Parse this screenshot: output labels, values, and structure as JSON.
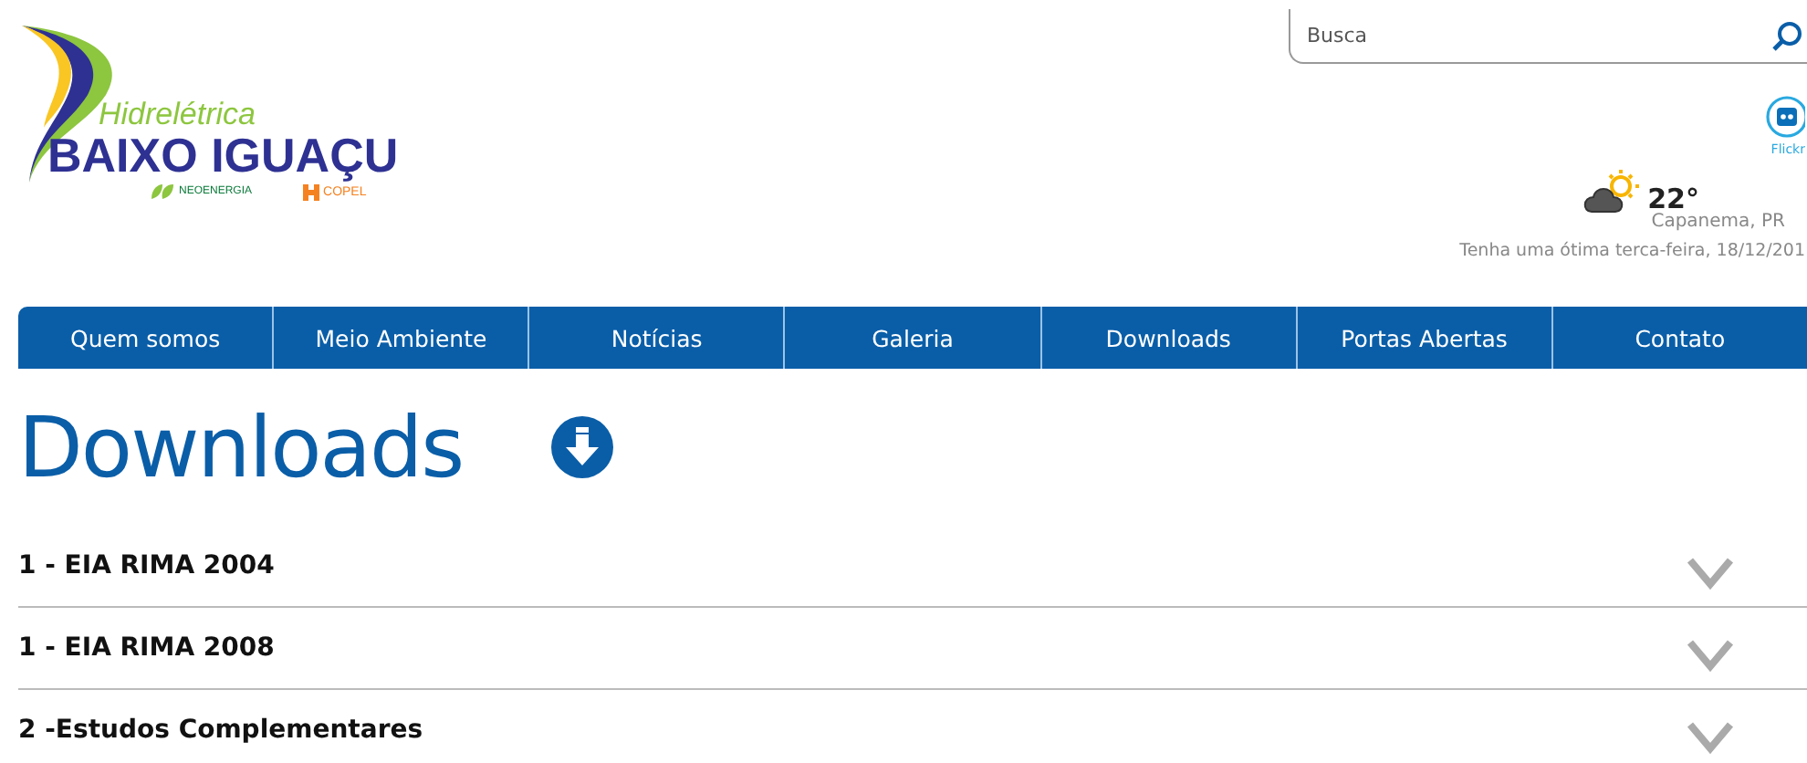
{
  "logo": {
    "subtitle": "Hidrelétrica",
    "name": "BAIXO IGUAÇU",
    "partners": [
      "NEOENERGIA",
      "COPEL"
    ]
  },
  "search": {
    "placeholder": "Busca"
  },
  "social": {
    "label": "Flickr"
  },
  "weather": {
    "temperature": "22°",
    "city": "Capanema, PR",
    "greeting": "Tenha uma ótima terca-feira, 18/12/201"
  },
  "nav": [
    "Quem somos",
    "Meio Ambiente",
    "Notícias",
    "Galeria",
    "Downloads",
    "Portas Abertas",
    "Contato"
  ],
  "page_title": "Downloads",
  "sections": [
    {
      "title": "1 - EIA RIMA 2004",
      "expanded": false
    },
    {
      "title": "1 - EIA RIMA 2008",
      "expanded": false
    },
    {
      "title": "2 -Estudos Complementares",
      "expanded": false
    }
  ]
}
